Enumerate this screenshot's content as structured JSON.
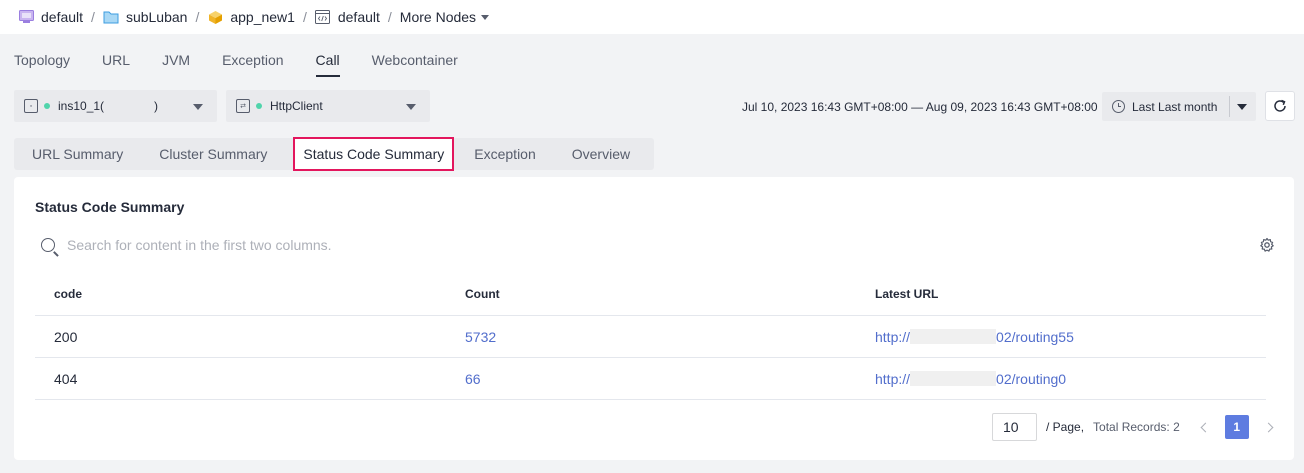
{
  "breadcrumb": {
    "items": [
      {
        "label": "default",
        "icon": "workspace-icon"
      },
      {
        "label": "subLuban",
        "icon": "folder-icon"
      },
      {
        "label": "app_new1",
        "icon": "app-cube-icon"
      },
      {
        "label": "default",
        "icon": "code-env-icon"
      }
    ],
    "separator": "/",
    "more_nodes": "More Nodes"
  },
  "top_tabs": [
    {
      "label": "Topology",
      "active": false
    },
    {
      "label": "URL",
      "active": false
    },
    {
      "label": "JVM",
      "active": false
    },
    {
      "label": "Exception",
      "active": false
    },
    {
      "label": "Call",
      "active": true
    },
    {
      "label": "Webcontainer",
      "active": false
    }
  ],
  "instance_select": {
    "label": "ins10_1(",
    "suffix": ")"
  },
  "client_select": {
    "label": "HttpClient"
  },
  "time": {
    "range": "Jul 10, 2023 16:43 GMT+08:00 — Aug 09, 2023 16:43 GMT+08:00",
    "preset": "Last Last month"
  },
  "sub_tabs": [
    {
      "label": "URL Summary",
      "active": false
    },
    {
      "label": "Cluster Summary",
      "active": false
    },
    {
      "label": "Status Code Summary",
      "active": true
    },
    {
      "label": "Exception",
      "active": false
    },
    {
      "label": "Overview",
      "active": false
    }
  ],
  "card": {
    "title": "Status Code Summary",
    "search_placeholder": "Search for content in the first two columns."
  },
  "table": {
    "columns": [
      "code",
      "Count",
      "Latest URL"
    ],
    "rows": [
      {
        "code": "200",
        "count": "5732",
        "url_prefix": "http://",
        "url_suffix": "02/routing55"
      },
      {
        "code": "404",
        "count": "66",
        "url_prefix": "http://",
        "url_suffix": "02/routing0"
      }
    ]
  },
  "pagination": {
    "page_size": "10",
    "per_page_label": "/ Page,",
    "total_label": "Total Records: 2",
    "current_page": "1"
  },
  "colors": {
    "accent": "#5e7ce0",
    "link": "#526ecc",
    "highlight_border": "#e3165d",
    "status_dot": "#50d4ab"
  }
}
